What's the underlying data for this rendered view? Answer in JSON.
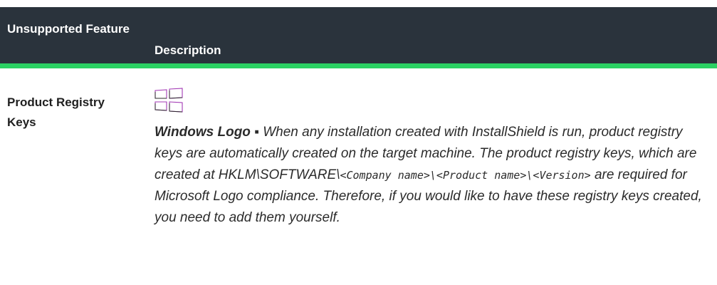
{
  "table": {
    "header": {
      "feature_col": "Unsupported Feature",
      "description_col": "Description"
    },
    "rows": [
      {
        "feature": "Product Registry Keys",
        "icon": "windows-logo-icon",
        "description": {
          "lead": "Windows Logo",
          "bullet": "▪",
          "text_1": "When any installation created with InstallShield is run, product registry keys are automatically created on the target machine. The product registry keys, which are created at",
          "registry_path_prefix": "HKLM\\SOFTWARE\\",
          "registry_path_rest": "<Company name>\\<Product name>\\<Version>",
          "text_2": "are required for Microsoft Logo compliance. Therefore, if you would like to have these registry keys created, you need to add them yourself."
        }
      }
    ]
  },
  "colors": {
    "header_bg": "#2a333c",
    "header_accent": "#2bd163",
    "logo_stroke": "#a33ab5"
  }
}
